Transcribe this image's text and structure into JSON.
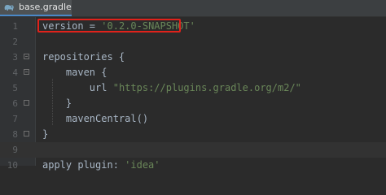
{
  "tab": {
    "title": "base.gradle",
    "icon": "gradle-elephant-icon"
  },
  "lines": [
    {
      "n": "1",
      "tokens": [
        "version",
        " = ",
        "'0.2.0-SNAPSHOT'"
      ]
    },
    {
      "n": "2"
    },
    {
      "n": "3",
      "tokens": [
        "repositories",
        " {"
      ]
    },
    {
      "n": "4",
      "tokens": [
        "maven",
        " {"
      ]
    },
    {
      "n": "5",
      "tokens": [
        "url",
        " ",
        "\"https://plugins.gradle.org/m2/\""
      ]
    },
    {
      "n": "6",
      "tokens": [
        "}"
      ]
    },
    {
      "n": "7",
      "tokens": [
        "mavenCentral",
        "()"
      ]
    },
    {
      "n": "8",
      "tokens": [
        "}"
      ]
    },
    {
      "n": "9"
    },
    {
      "n": "10",
      "tokens": [
        "apply",
        " plugin: ",
        "'idea'"
      ]
    }
  ],
  "colors": {
    "background": "#2b2b2b",
    "gutter": "#313335",
    "keyword": "#cc7832",
    "string": "#6a8759",
    "text": "#a9b7c6",
    "line_number": "#606366",
    "annotation_box": "#e0221b",
    "tab_underline": "#4a88c7"
  }
}
